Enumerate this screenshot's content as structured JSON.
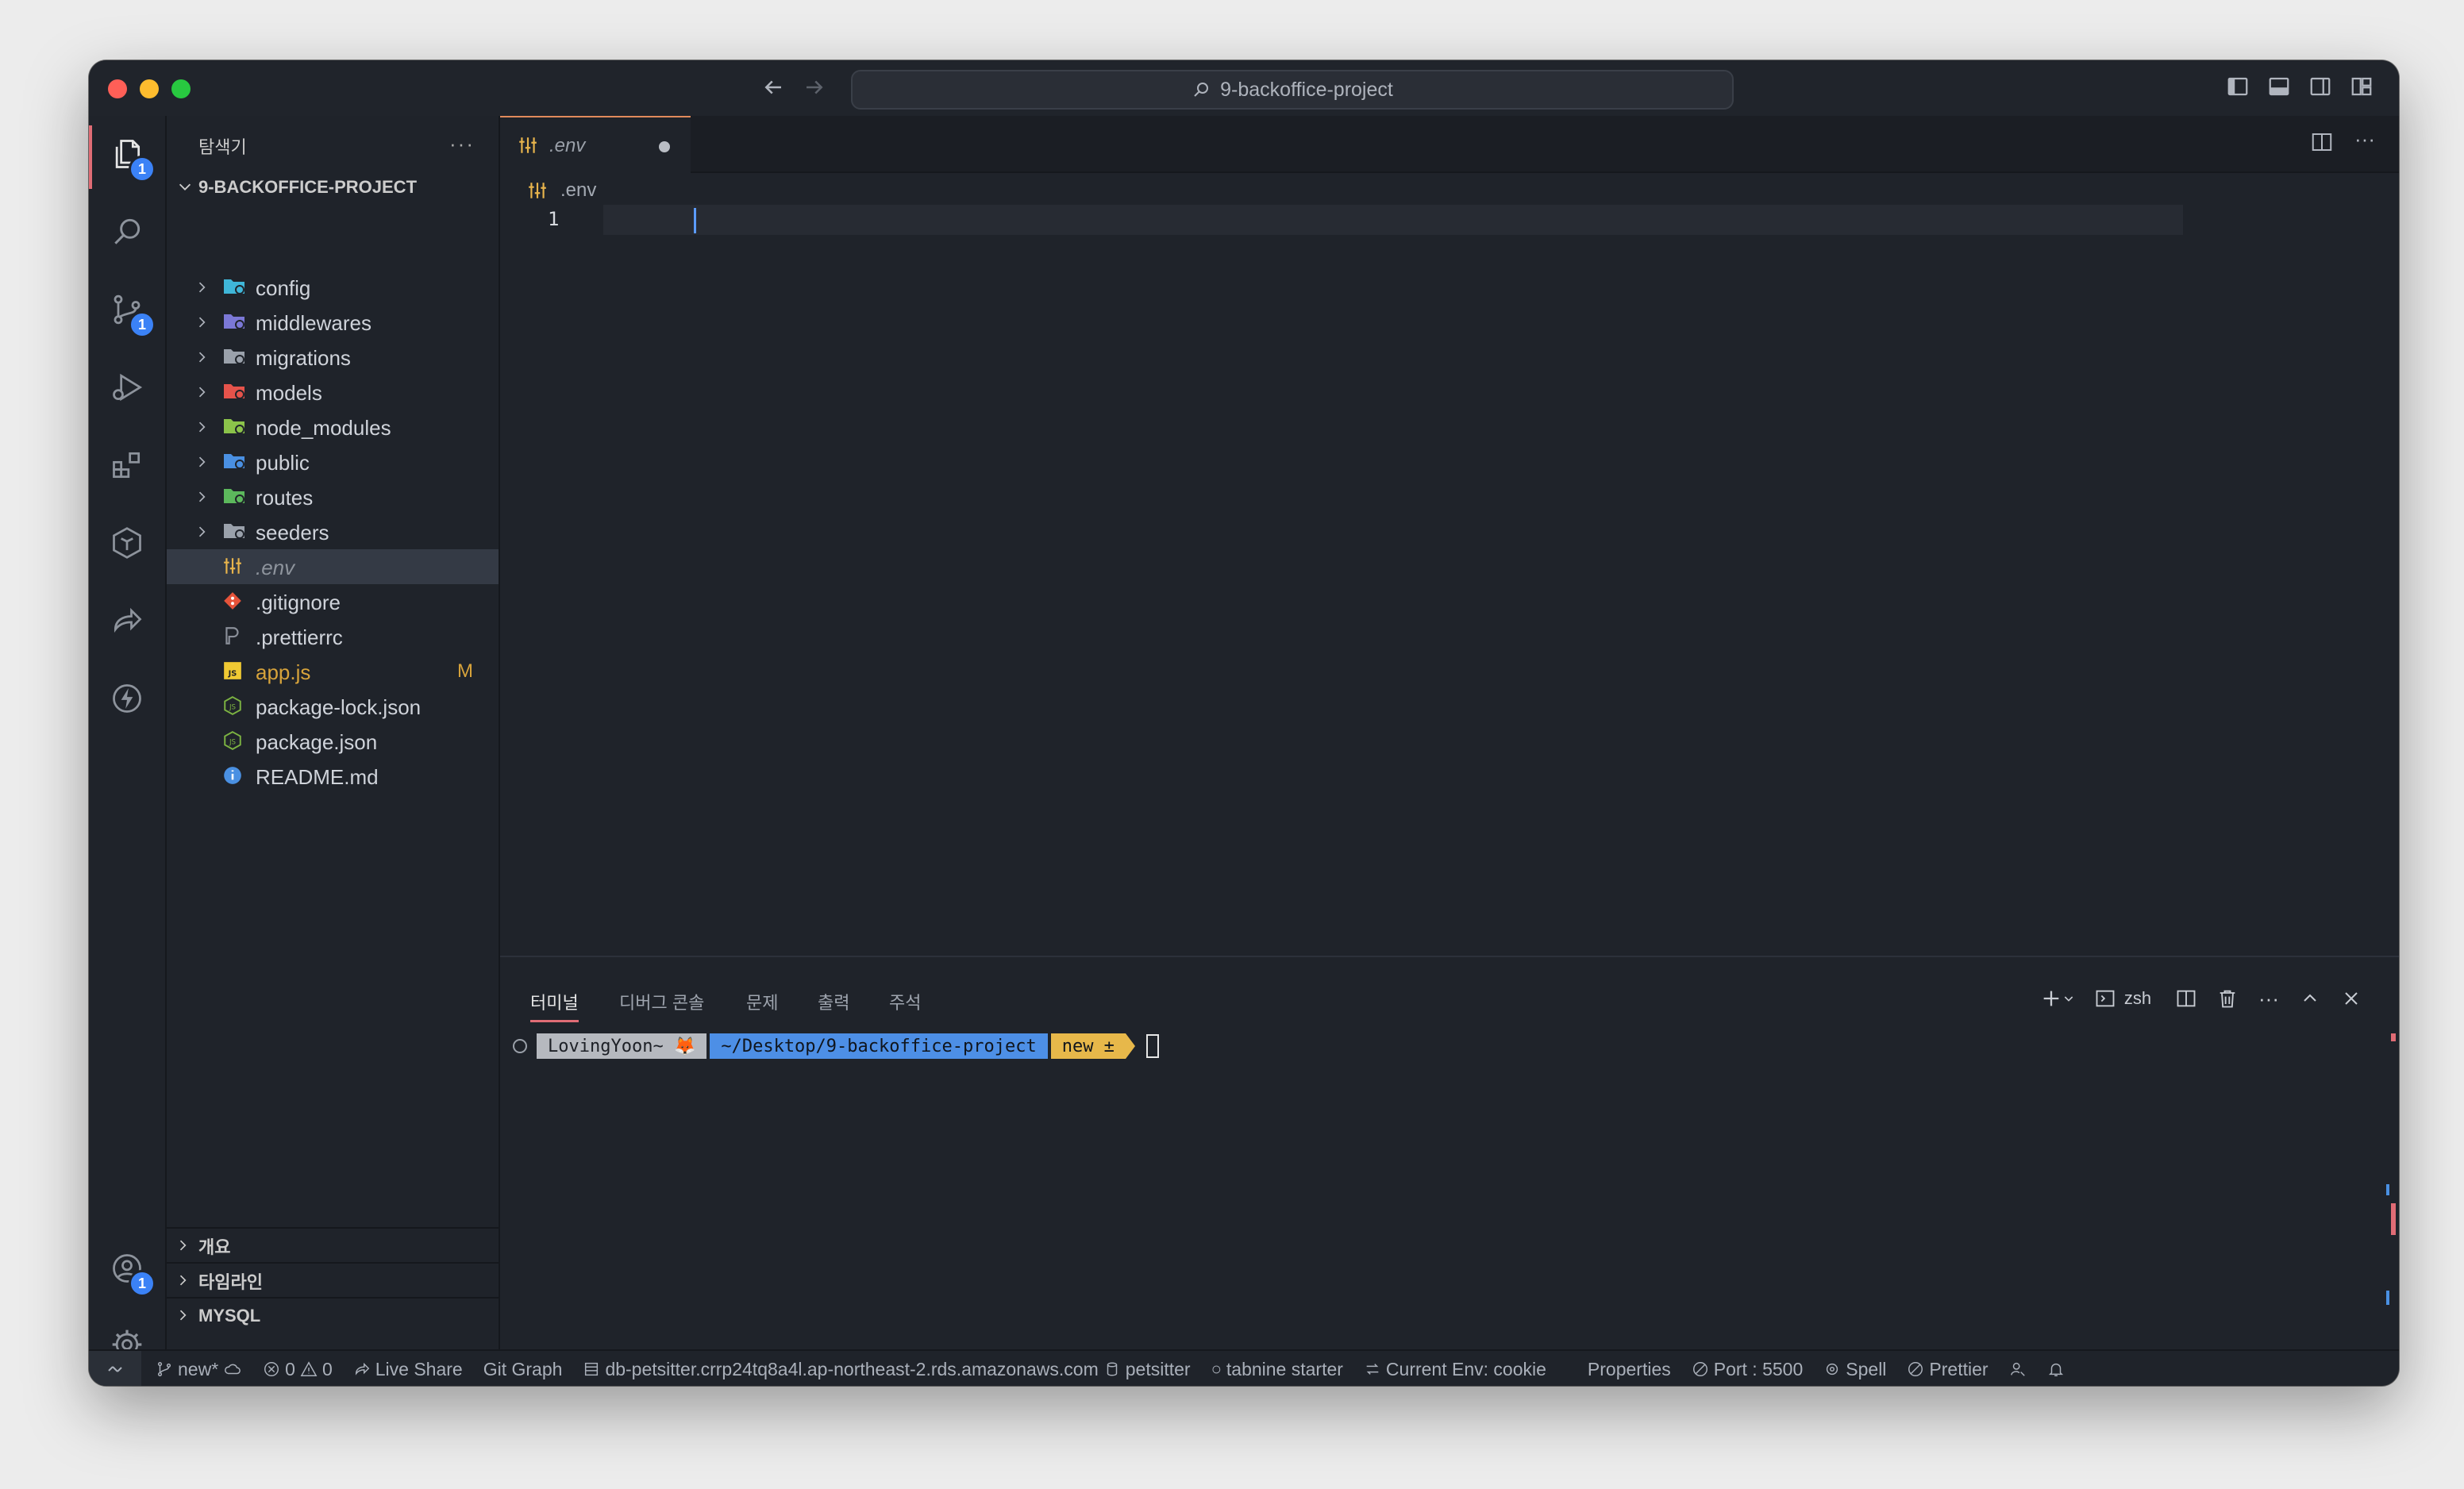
{
  "window": {
    "search_text": "9-backoffice-project"
  },
  "activity_bar": {
    "explorer_badge": "1",
    "scm_badge": "1",
    "accounts_badge": "1"
  },
  "sidebar": {
    "title": "탐색기",
    "project": "9-BACKOFFICE-PROJECT",
    "items": [
      {
        "label": "config",
        "type": "folder",
        "color": "#3fb6d8"
      },
      {
        "label": "middlewares",
        "type": "folder",
        "color": "#7b78d6"
      },
      {
        "label": "migrations",
        "type": "folder",
        "color": "#9aa1ab"
      },
      {
        "label": "models",
        "type": "folder",
        "color": "#e5534b"
      },
      {
        "label": "node_modules",
        "type": "folder",
        "color": "#8bc34a"
      },
      {
        "label": "public",
        "type": "folder",
        "color": "#4a90e2"
      },
      {
        "label": "routes",
        "type": "folder",
        "color": "#5cb85c"
      },
      {
        "label": "seeders",
        "type": "folder",
        "color": "#9aa1ab"
      },
      {
        "label": ".env",
        "type": "env",
        "color": "#e8b44c"
      },
      {
        "label": ".gitignore",
        "type": "git",
        "color": "#e5533a"
      },
      {
        "label": ".prettierrc",
        "type": "prettier",
        "color": "#8a8f99"
      },
      {
        "label": "app.js",
        "type": "js",
        "color": "#f0c933",
        "badge": "M"
      },
      {
        "label": "package-lock.json",
        "type": "node",
        "color": "#7cb342"
      },
      {
        "label": "package.json",
        "type": "node",
        "color": "#7cb342"
      },
      {
        "label": "README.md",
        "type": "info",
        "color": "#4a90e2"
      }
    ],
    "bottom": [
      "개요",
      "타임라인",
      "MYSQL"
    ]
  },
  "editor": {
    "tab_label": ".env",
    "breadcrumb": ".env",
    "line_number": "1"
  },
  "panel": {
    "tabs": [
      "터미널",
      "디버그 콘솔",
      "문제",
      "출력",
      "주석"
    ],
    "shell": "zsh",
    "prompt_user": "LovingYoon~ 🦊",
    "prompt_path": "~/Desktop/9-backoffice-project",
    "prompt_branch": "new ±"
  },
  "status_bar": {
    "branch": "new*",
    "errors": "0",
    "warnings": "0",
    "live_share": "Live Share",
    "git_graph": "Git Graph",
    "db_host": "db-petsitter.crrp24tq8a4l.ap-northeast-2.rds.amazonaws.com",
    "db_name": "petsitter",
    "tabnine": "tabnine starter",
    "env": "Current Env: cookie",
    "properties": "Properties",
    "port": "Port : 5500",
    "spell": "Spell",
    "prettier": "Prettier"
  },
  "colors": {
    "accent_red": "#e06c75",
    "badge_blue": "#3b82f6",
    "modified_yellow": "#d7a33b",
    "prompt_gray": "#b6b9bf",
    "prompt_blue": "#4d8fe6",
    "prompt_yellow": "#e7b84a"
  }
}
